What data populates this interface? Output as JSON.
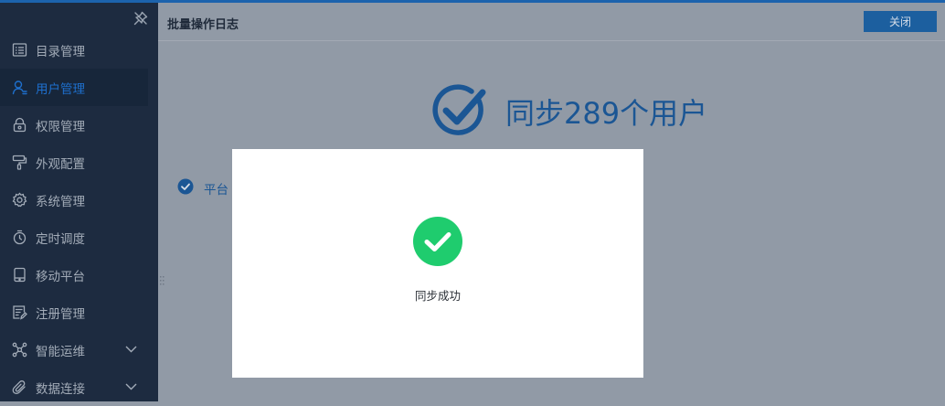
{
  "sidebar": {
    "items": [
      {
        "label": "目录管理",
        "icon": "list-icon",
        "active": false
      },
      {
        "label": "用户管理",
        "icon": "user-icon",
        "active": true
      },
      {
        "label": "权限管理",
        "icon": "lock-icon",
        "active": false
      },
      {
        "label": "外观配置",
        "icon": "paint-roller-icon",
        "active": false
      },
      {
        "label": "系统管理",
        "icon": "gear-icon",
        "active": false
      },
      {
        "label": "定时调度",
        "icon": "timer-icon",
        "active": false
      },
      {
        "label": "移动平台",
        "icon": "tablet-icon",
        "active": false
      },
      {
        "label": "注册管理",
        "icon": "edit-document-icon",
        "active": false
      },
      {
        "label": "智能运维",
        "icon": "network-icon",
        "active": false,
        "expandable": true
      },
      {
        "label": "数据连接",
        "icon": "paperclip-icon",
        "active": false,
        "expandable": true
      }
    ]
  },
  "header": {
    "title": "批量操作日志",
    "close_label": "关闭"
  },
  "result": {
    "headline": "同步289个用户",
    "platform_label": "平台"
  },
  "modal": {
    "message": "同步成功"
  },
  "colors": {
    "accent": "#1c63ad",
    "success": "#1fcc6e",
    "sidebar_bg": "#1d2b40"
  }
}
